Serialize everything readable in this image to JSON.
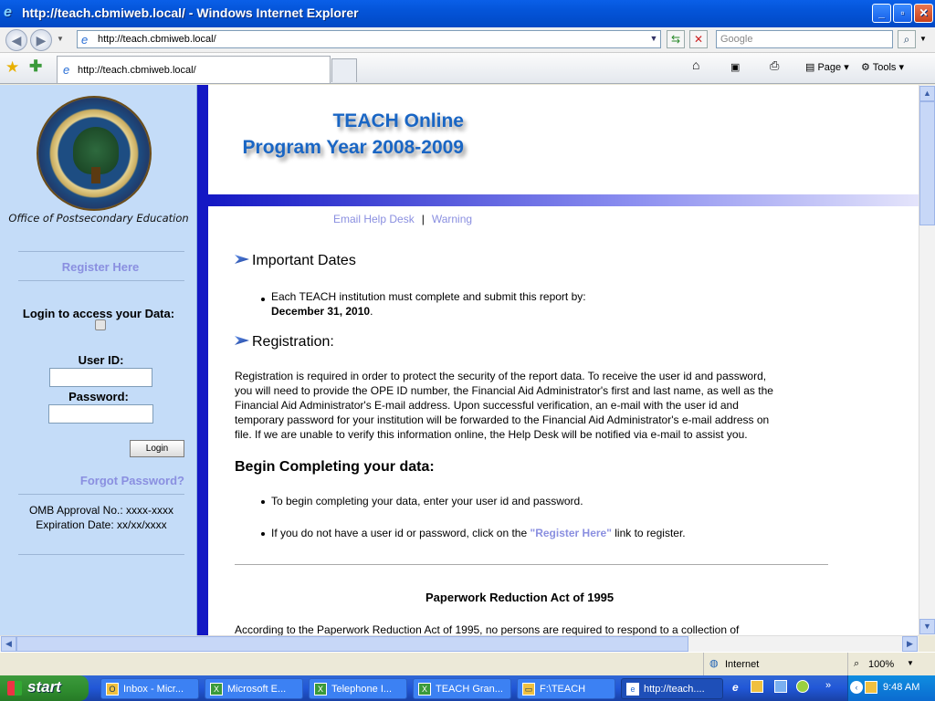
{
  "browser": {
    "title": "http://teach.cbmiweb.local/ - Windows Internet Explorer",
    "address": "http://teach.cbmiweb.local/",
    "search_placeholder": "Google",
    "tab_label": "http://teach.cbmiweb.local/",
    "tools": {
      "page": "Page",
      "tools": "Tools"
    }
  },
  "sidebar": {
    "office": "Office of Postsecondary Education",
    "register": "Register Here",
    "login_heading": "Login to access your Data:",
    "user_id_label": "User ID:",
    "password_label": "Password:",
    "login_button": "Login",
    "forgot": "Forgot Password?",
    "omb_line1": "OMB Approval No.: xxxx-xxxx",
    "omb_line2": "Expiration Date: xx/xx/xxxx"
  },
  "header": {
    "line1": "TEACH Online",
    "line2": "Program Year 2008-2009"
  },
  "links": {
    "email": "Email Help Desk",
    "sep": "|",
    "warning": "Warning"
  },
  "main": {
    "important_title": "Important Dates",
    "important_text": "Each TEACH institution must complete and submit this report by:",
    "important_date": "December 31, 2010",
    "important_period": ".",
    "registration_title": "Registration:",
    "registration_lines": [
      "Registration is required in order to protect the security of the report data. To receive the user id and password,",
      "you will need to provide the OPE ID number, the Financial Aid Administrator's first and last name, as well as the",
      "Financial Aid Administrator's E-mail address. Upon successful verification, an e-mail with the user id and",
      "temporary password for your institution will be forwarded to the Financial Aid Administrator's e-mail address on",
      "file. If we are unable to verify this information online, the Help Desk will be notified via e-mail to assist you."
    ],
    "begin_title": "Begin Completing your data:",
    "begin_bullet1": "To begin completing your data, enter your user id and password.",
    "begin_bullet2_pre": "If you do not have a user id or password, click on the ",
    "begin_bullet2_link": "\"Register Here\"",
    "begin_bullet2_post": " link to register.",
    "pra_title": "Paperwork Reduction Act of 1995",
    "pra_text": "According to the Paperwork Reduction Act of 1995, no persons are required to respond to a collection of"
  },
  "status": {
    "zone": "Internet",
    "zoom": "100%"
  },
  "taskbar": {
    "start": "start",
    "tasks": [
      "Inbox - Micr...",
      "Microsoft E...",
      "Telephone I...",
      "TEACH Gran...",
      "F:\\TEACH",
      "http://teach...."
    ],
    "time": "9:48 AM"
  },
  "colors": {
    "accent_blue": "#1418c4",
    "link": "#8a8fe0",
    "sidebar_bg": "#c4dcf8",
    "title_blue": "#1a66c4"
  }
}
